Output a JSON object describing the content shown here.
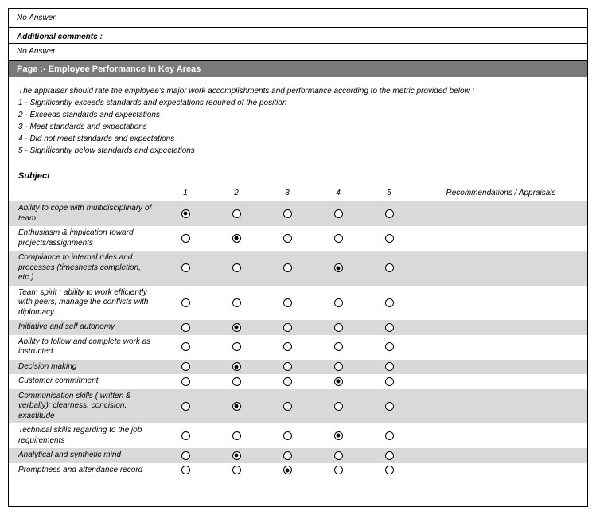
{
  "top": {
    "noAnswer1": "No Answer",
    "additionalCommentsLabel": "Additional comments :",
    "noAnswer2": "No Answer"
  },
  "pageHeader": "Page :- Employee Performance In Key Areas",
  "instructions": {
    "intro": "The appraiser should rate the employee's major work accomplishments and performance according to the metric provided below :",
    "scale": [
      "1 - Significantly exceeds standards and expectations required of the position",
      "2 - Exceeds standards and expectations",
      "3 - Meet standards and expectations",
      "4 - Did not meet standards and expectations",
      "5 - Significantly below standards and expectations"
    ]
  },
  "subjectLabel": "Subject",
  "columns": {
    "ratings": [
      "1",
      "2",
      "3",
      "4",
      "5"
    ],
    "recommendations": "Recommendations / Appraisals"
  },
  "rows": [
    {
      "label": "Ability to cope with multidisciplinary of team",
      "selected": 1,
      "shaded": true
    },
    {
      "label": "Enthusiasm & implication toward projects/assignments",
      "selected": 2,
      "shaded": false
    },
    {
      "label": "Compliance to internal rules and processes (timesheets completion, etc.)",
      "selected": 4,
      "shaded": true
    },
    {
      "label": "Team spirit : ability to work efficiently with peers, manage the conflicts with diplomacy",
      "selected": 0,
      "shaded": false
    },
    {
      "label": "Initiative and self autonomy",
      "selected": 2,
      "shaded": true
    },
    {
      "label": "Ability to follow and complete work as instructed",
      "selected": 0,
      "shaded": false
    },
    {
      "label": "Decision making",
      "selected": 2,
      "shaded": true
    },
    {
      "label": "Customer commitment",
      "selected": 4,
      "shaded": false
    },
    {
      "label": "Communication skills ( written & verbally): clearness, concision, exactitude",
      "selected": 2,
      "shaded": true
    },
    {
      "label": "Technical skills regarding to the job requirements",
      "selected": 4,
      "shaded": false
    },
    {
      "label": "Analytical and synthetic mind",
      "selected": 2,
      "shaded": true
    },
    {
      "label": "Promptness and attendance record",
      "selected": 3,
      "shaded": false
    }
  ]
}
